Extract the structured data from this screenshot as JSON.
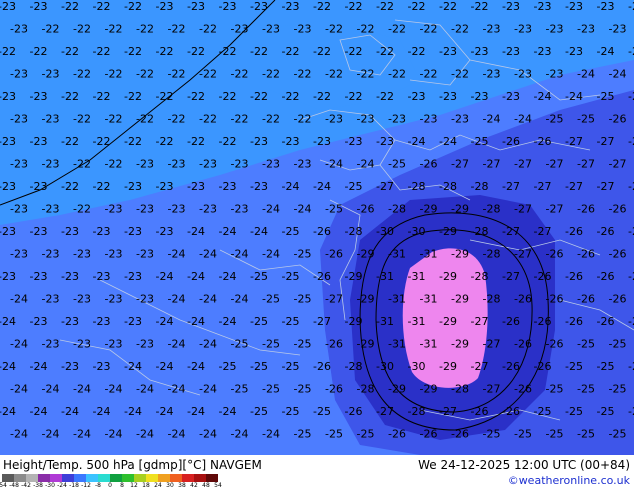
{
  "title": "Height/Temp. 500 hPa [gdmp][°C] NAVGEM",
  "valid_time": "We 24-12-2025 12:00 UTC (00+84)",
  "credit": "©weatheronline.co.uk",
  "colors": {
    "t_m23": "#4d7dff",
    "t_m22": "#3b96ff",
    "t_m26": "#3e56ea",
    "t_m28": "#2a30c8",
    "t_m30": "#ee86ee",
    "contour": "#000000",
    "border": "#b8c8e8"
  },
  "colorbar": {
    "tick_labels": [
      "-54",
      "-48",
      "-42",
      "-38",
      "-30",
      "-24",
      "-18",
      "-12",
      "-8",
      "0",
      "8",
      "12",
      "18",
      "24",
      "30",
      "38",
      "42",
      "48",
      "54"
    ],
    "colors": [
      "#5a5a5a",
      "#8c8c8c",
      "#b4b4b4",
      "#8a2da8",
      "#b03ad6",
      "#3e3ed8",
      "#3b78ff",
      "#3bc3ff",
      "#2adcd0",
      "#10a040",
      "#2ec02e",
      "#a8d020",
      "#f0e020",
      "#f0a020",
      "#f06020",
      "#d82020",
      "#a81010",
      "#600808"
    ]
  },
  "temperature_labels": {
    "rows": [
      [
        "-23",
        "-23",
        "-22",
        "-22",
        "-22",
        "-23",
        "-23",
        "-23",
        "-23",
        "-23",
        "-22",
        "-22",
        "-22",
        "-22",
        "-22",
        "-22",
        "-23",
        "-23",
        "-23",
        "-23",
        "-24"
      ],
      [
        "-23",
        "-22",
        "-22",
        "-22",
        "-22",
        "-22",
        "-22",
        "-23",
        "-23",
        "-23",
        "-22",
        "-22",
        "-22",
        "-22",
        "-22",
        "-23",
        "-23",
        "-23",
        "-23",
        "-23",
        "-24"
      ],
      [
        "-22",
        "-22",
        "-22",
        "-22",
        "-22",
        "-22",
        "-22",
        "-22",
        "-22",
        "-22",
        "-22",
        "-22",
        "-22",
        "-22",
        "-23",
        "-23",
        "-23",
        "-23",
        "-23",
        "-24",
        "-24"
      ],
      [
        "-23",
        "-23",
        "-22",
        "-22",
        "-22",
        "-22",
        "-22",
        "-22",
        "-22",
        "-22",
        "-22",
        "-22",
        "-22",
        "-22",
        "-22",
        "-23",
        "-23",
        "-23",
        "-24",
        "-24",
        "-25"
      ],
      [
        "-23",
        "-23",
        "-22",
        "-22",
        "-22",
        "-22",
        "-22",
        "-22",
        "-22",
        "-22",
        "-22",
        "-22",
        "-22",
        "-23",
        "-23",
        "-23",
        "-23",
        "-24",
        "-24",
        "-25",
        "-25"
      ],
      [
        "-23",
        "-23",
        "-22",
        "-22",
        "-22",
        "-22",
        "-22",
        "-22",
        "-22",
        "-22",
        "-23",
        "-23",
        "-23",
        "-23",
        "-23",
        "-24",
        "-24",
        "-25",
        "-25",
        "-26",
        "-26"
      ],
      [
        "-23",
        "-23",
        "-22",
        "-22",
        "-22",
        "-22",
        "-22",
        "-22",
        "-23",
        "-23",
        "-23",
        "-23",
        "-23",
        "-24",
        "-24",
        "-25",
        "-26",
        "-26",
        "-27",
        "-27",
        "-27"
      ],
      [
        "-23",
        "-23",
        "-22",
        "-22",
        "-23",
        "-23",
        "-23",
        "-23",
        "-23",
        "-23",
        "-24",
        "-24",
        "-25",
        "-26",
        "-27",
        "-27",
        "-27",
        "-27",
        "-27",
        "-27",
        "-27"
      ],
      [
        "-23",
        "-23",
        "-22",
        "-22",
        "-23",
        "-23",
        "-23",
        "-23",
        "-23",
        "-24",
        "-24",
        "-25",
        "-27",
        "-28",
        "-28",
        "-28",
        "-27",
        "-27",
        "-27",
        "-27",
        "-27"
      ],
      [
        "-23",
        "-23",
        "-22",
        "-23",
        "-23",
        "-23",
        "-23",
        "-23",
        "-24",
        "-24",
        "-25",
        "-26",
        "-28",
        "-29",
        "-29",
        "-28",
        "-27",
        "-27",
        "-26",
        "-26",
        "-26"
      ],
      [
        "-23",
        "-23",
        "-23",
        "-23",
        "-23",
        "-23",
        "-24",
        "-24",
        "-24",
        "-25",
        "-26",
        "-28",
        "-30",
        "-30",
        "-29",
        "-28",
        "-27",
        "-27",
        "-26",
        "-26",
        "-26"
      ],
      [
        "-23",
        "-23",
        "-23",
        "-23",
        "-23",
        "-24",
        "-24",
        "-24",
        "-24",
        "-25",
        "-26",
        "-29",
        "-31",
        "-31",
        "-29",
        "-28",
        "-27",
        "-26",
        "-26",
        "-26",
        "-26"
      ],
      [
        "-23",
        "-23",
        "-23",
        "-23",
        "-23",
        "-24",
        "-24",
        "-24",
        "-25",
        "-25",
        "-26",
        "-29",
        "-31",
        "-31",
        "-29",
        "-28",
        "-27",
        "-26",
        "-26",
        "-26",
        "-26"
      ],
      [
        "-24",
        "-23",
        "-23",
        "-23",
        "-23",
        "-24",
        "-24",
        "-24",
        "-25",
        "-25",
        "-27",
        "-29",
        "-31",
        "-31",
        "-29",
        "-28",
        "-26",
        "-26",
        "-26",
        "-26",
        "-26"
      ],
      [
        "-24",
        "-23",
        "-23",
        "-23",
        "-23",
        "-24",
        "-24",
        "-24",
        "-25",
        "-25",
        "-27",
        "-29",
        "-31",
        "-31",
        "-29",
        "-27",
        "-26",
        "-26",
        "-26",
        "-26",
        "-26"
      ],
      [
        "-24",
        "-23",
        "-23",
        "-23",
        "-23",
        "-24",
        "-24",
        "-25",
        "-25",
        "-25",
        "-26",
        "-29",
        "-31",
        "-31",
        "-29",
        "-27",
        "-26",
        "-26",
        "-25",
        "-25",
        "-25"
      ],
      [
        "-24",
        "-24",
        "-23",
        "-23",
        "-24",
        "-24",
        "-24",
        "-25",
        "-25",
        "-25",
        "-26",
        "-28",
        "-30",
        "-30",
        "-29",
        "-27",
        "-26",
        "-26",
        "-25",
        "-25",
        "-25"
      ],
      [
        "-24",
        "-24",
        "-24",
        "-24",
        "-24",
        "-24",
        "-24",
        "-25",
        "-25",
        "-25",
        "-26",
        "-28",
        "-29",
        "-29",
        "-28",
        "-27",
        "-26",
        "-25",
        "-25",
        "-25",
        "-25"
      ],
      [
        "-24",
        "-24",
        "-24",
        "-24",
        "-24",
        "-24",
        "-24",
        "-24",
        "-25",
        "-25",
        "-25",
        "-26",
        "-27",
        "-28",
        "-27",
        "-26",
        "-26",
        "-25",
        "-25",
        "-25",
        "-25"
      ],
      [
        "-24",
        "-24",
        "-24",
        "-24",
        "-24",
        "-24",
        "-24",
        "-24",
        "-24",
        "-25",
        "-25",
        "-25",
        "-26",
        "-26",
        "-26",
        "-25",
        "-25",
        "-25",
        "-25",
        "-25",
        "-25"
      ]
    ]
  }
}
